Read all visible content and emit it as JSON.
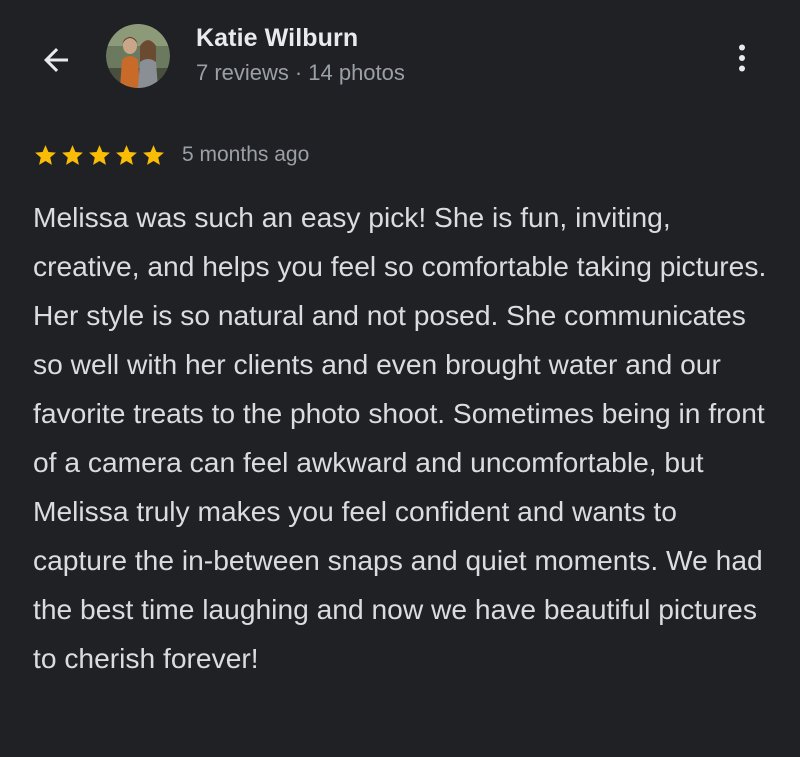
{
  "header": {
    "back_icon": "arrow-back-icon",
    "more_icon": "more-vert-icon"
  },
  "reviewer": {
    "name": "Katie Wilburn",
    "reviews": "7 reviews",
    "separator": "·",
    "photos": "14 photos",
    "avatar_icon": "avatar-photo"
  },
  "review": {
    "rating": 5,
    "rating_max": 5,
    "star_color": "#fbbc04",
    "date": "5 months ago",
    "text": "Melissa was such an easy pick! She is fun, inviting, creative, and helps you feel so comfortable taking pictures. Her style is so natural and not posed. She communicates so well with her clients and even brought water and our favorite treats to the photo shoot. Sometimes being in front of a camera can feel awkward and uncomfortable, but Melissa truly makes you feel confident and wants to capture the in-between snaps and quiet moments. We had the best time laughing and now we have beautiful pictures to cherish forever!"
  },
  "colors": {
    "background": "#202124",
    "primary_text": "#e8eaed",
    "secondary_text": "#9aa0a6"
  }
}
